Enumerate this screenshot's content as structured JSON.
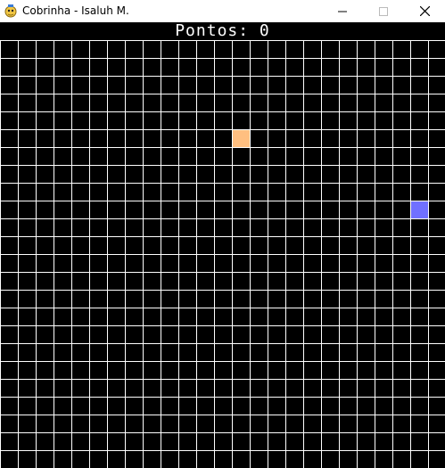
{
  "window": {
    "title": "Cobrinha - Isaluh M.",
    "app_icon": "pygame-snake-icon",
    "controls": {
      "minimize_icon": "minimize-icon",
      "maximize_icon": "maximize-icon",
      "close_icon": "close-icon"
    }
  },
  "game": {
    "score_text": "Pontos: 0",
    "score": 0,
    "grid": {
      "columns": 25,
      "rows": 24,
      "line_color": "#ffffff",
      "background": "#000000"
    },
    "food": {
      "color": "#ffbf80",
      "cell": {
        "col": 13,
        "row": 5
      }
    },
    "snake": {
      "color": "#7070ff",
      "segments": [
        {
          "col": 23,
          "row": 9
        }
      ]
    }
  }
}
